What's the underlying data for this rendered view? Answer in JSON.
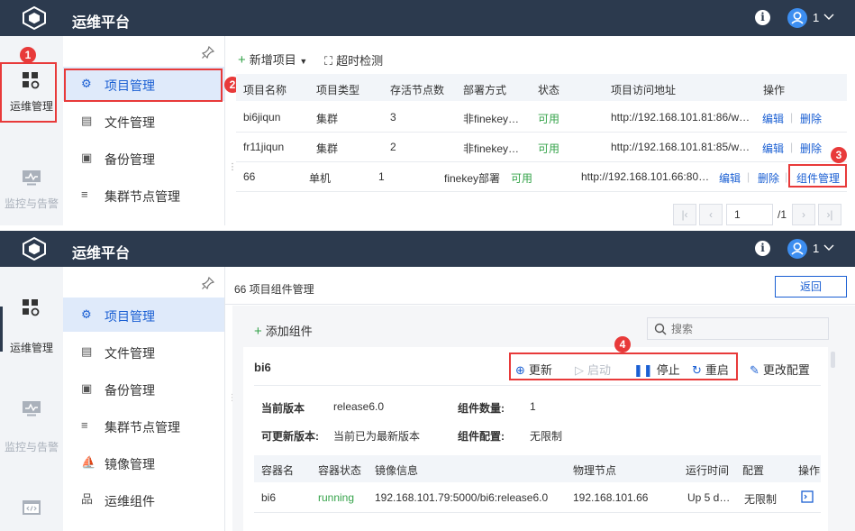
{
  "app": {
    "title": "运维平台",
    "info_glyph": "i",
    "user": "1"
  },
  "top": {
    "rail": {
      "ops": "运维管理",
      "monitor": "监控与告警"
    },
    "menu": [
      "项目管理",
      "文件管理",
      "备份管理",
      "集群节点管理"
    ],
    "toolbar": {
      "add": "新增项目",
      "timeout": "超时检测"
    },
    "columns": [
      "项目名称",
      "项目类型",
      "存活节点数",
      "部署方式",
      "状态",
      "项目访问地址",
      "操作"
    ],
    "rows": [
      {
        "name": "bi6jiqun",
        "type": "集群",
        "nodes": "3",
        "deploy": "非finekey…",
        "status": "可用",
        "url": "http://192.168.101.81:86/w…",
        "edit": "编辑",
        "del": "删除"
      },
      {
        "name": "fr11jiqun",
        "type": "集群",
        "nodes": "2",
        "deploy": "非finekey…",
        "status": "可用",
        "url": "http://192.168.101.81:85/w…",
        "edit": "编辑",
        "del": "删除"
      },
      {
        "name": "66",
        "type": "单机",
        "nodes": "1",
        "deploy": "finekey部署",
        "status": "可用",
        "url": "http://192.168.101.66:80…",
        "edit": "编辑",
        "del": "删除",
        "comp": "组件管理"
      }
    ],
    "pager": {
      "page": "1",
      "total": "/1"
    },
    "markers": [
      "1",
      "2",
      "3"
    ]
  },
  "bottom": {
    "rail": {
      "ops": "运维管理",
      "monitor": "监控与告警"
    },
    "menu": [
      "项目管理",
      "文件管理",
      "备份管理",
      "集群节点管理",
      "镜像管理",
      "运维组件"
    ],
    "page_title": "66 项目组件管理",
    "back": "返回",
    "add_component": "添加组件",
    "search_placeholder": "搜索",
    "card": {
      "name": "bi6",
      "actions": {
        "update": "更新",
        "start": "启动",
        "stop": "停止",
        "restart": "重启",
        "config": "更改配置"
      },
      "info": {
        "cur_label": "当前版本",
        "cur_value": "release6.0",
        "count_label": "组件数量:",
        "count_value": "1",
        "upd_label": "可更新版本:",
        "upd_value": "当前已为最新版本",
        "cfg_label": "组件配置:",
        "cfg_value": "无限制"
      },
      "columns": [
        "容器名",
        "容器状态",
        "镜像信息",
        "物理节点",
        "运行时间",
        "配置",
        "操作"
      ],
      "row": {
        "name": "bi6",
        "state": "running",
        "image": "192.168.101.79:5000/bi6:release6.0",
        "node": "192.168.101.66",
        "uptime": "Up 5 d…",
        "config": "无限制"
      }
    },
    "marker": "4"
  },
  "colors": {
    "topbar": "#2c3a4e",
    "accent": "#1a5fd3",
    "green": "#35a34a",
    "marker": "#e83a3a"
  }
}
